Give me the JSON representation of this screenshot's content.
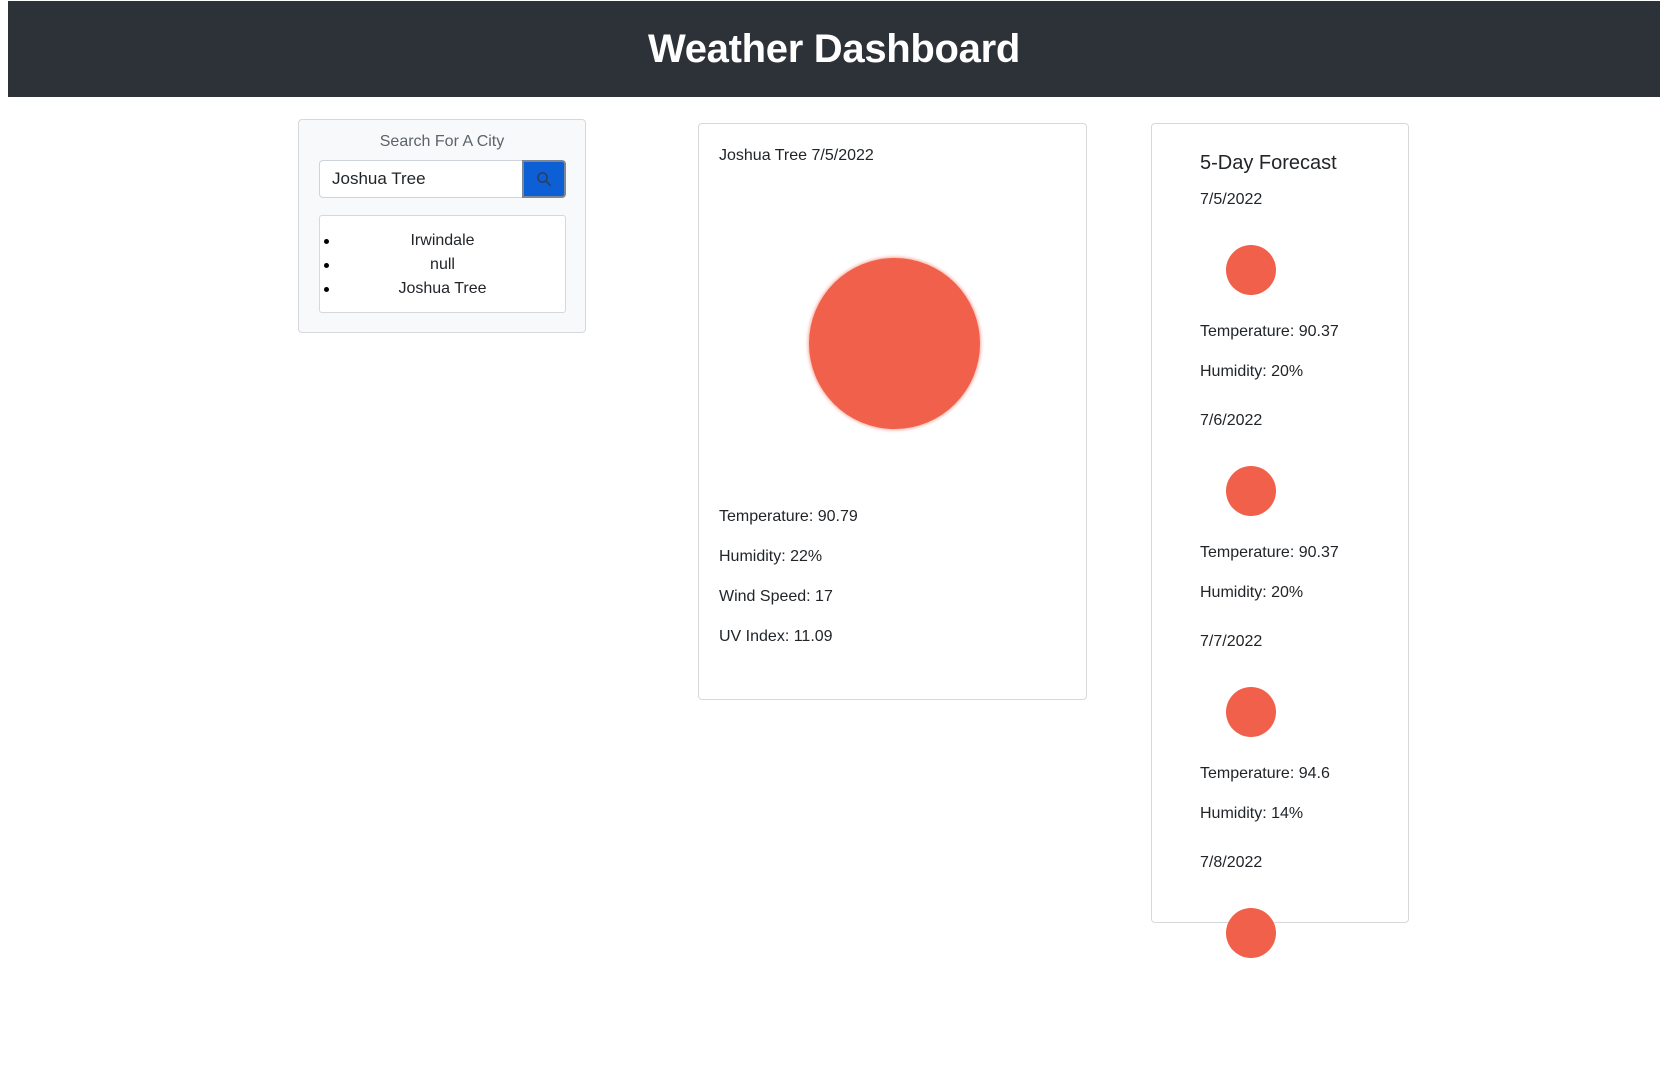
{
  "header": {
    "title": "Weather Dashboard"
  },
  "search": {
    "title": "Search For A City",
    "input_value": "Joshua Tree",
    "button_icon": "search-icon",
    "history": [
      "Irwindale",
      "null",
      "Joshua Tree"
    ]
  },
  "current": {
    "title": "Joshua Tree 7/5/2022",
    "icon": "sun-icon",
    "icon_color": "#f0604a",
    "temperature": "Temperature: 90.79",
    "humidity": "Humidity: 22%",
    "wind": "Wind Speed: 17",
    "uv": "UV Index: 11.09"
  },
  "forecast": {
    "heading": "5-Day Forecast",
    "days": [
      {
        "date": "7/5/2022",
        "icon": "sun-icon",
        "temperature": "Temperature: 90.37",
        "humidity": "Humidity: 20%"
      },
      {
        "date": "7/6/2022",
        "icon": "sun-icon",
        "temperature": "Temperature: 90.37",
        "humidity": "Humidity: 20%"
      },
      {
        "date": "7/7/2022",
        "icon": "sun-icon",
        "temperature": "Temperature: 94.6",
        "humidity": "Humidity: 14%"
      },
      {
        "date": "7/8/2022",
        "icon": "sun-icon",
        "temperature": "",
        "humidity": ""
      }
    ]
  },
  "colors": {
    "header_bg": "#2d3138",
    "accent": "#0d5fd6",
    "sun": "#f0604a"
  }
}
